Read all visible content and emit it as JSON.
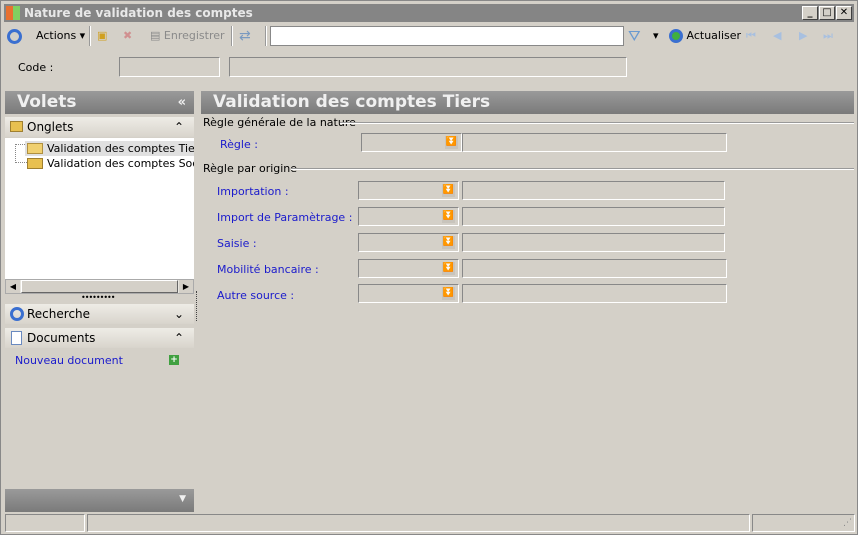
{
  "window": {
    "title": "Nature de validation des comptes"
  },
  "toolbar": {
    "actions": "Actions",
    "save": "Enregistrer",
    "search_value": "",
    "refresh": "Actualiser"
  },
  "code": {
    "label": "Code :",
    "value": "",
    "description": ""
  },
  "left": {
    "title": "Volets",
    "collapse": "«",
    "onglets": "Onglets",
    "tree": [
      "Validation des comptes Tiers",
      "Validation des comptes Société"
    ],
    "recherche": "Recherche",
    "documents": "Documents",
    "new_document": "Nouveau document"
  },
  "main": {
    "title": "Validation des comptes Tiers",
    "general_section": "Règle générale de la nature",
    "regle_label": "Règle :",
    "origin_section": "Règle par origine",
    "origins": [
      {
        "label": "Importation :"
      },
      {
        "label": "Import de Paramètrage :"
      },
      {
        "label": "Saisie :"
      },
      {
        "label": "Mobilité bancaire :"
      },
      {
        "label": "Autre source :"
      }
    ]
  }
}
